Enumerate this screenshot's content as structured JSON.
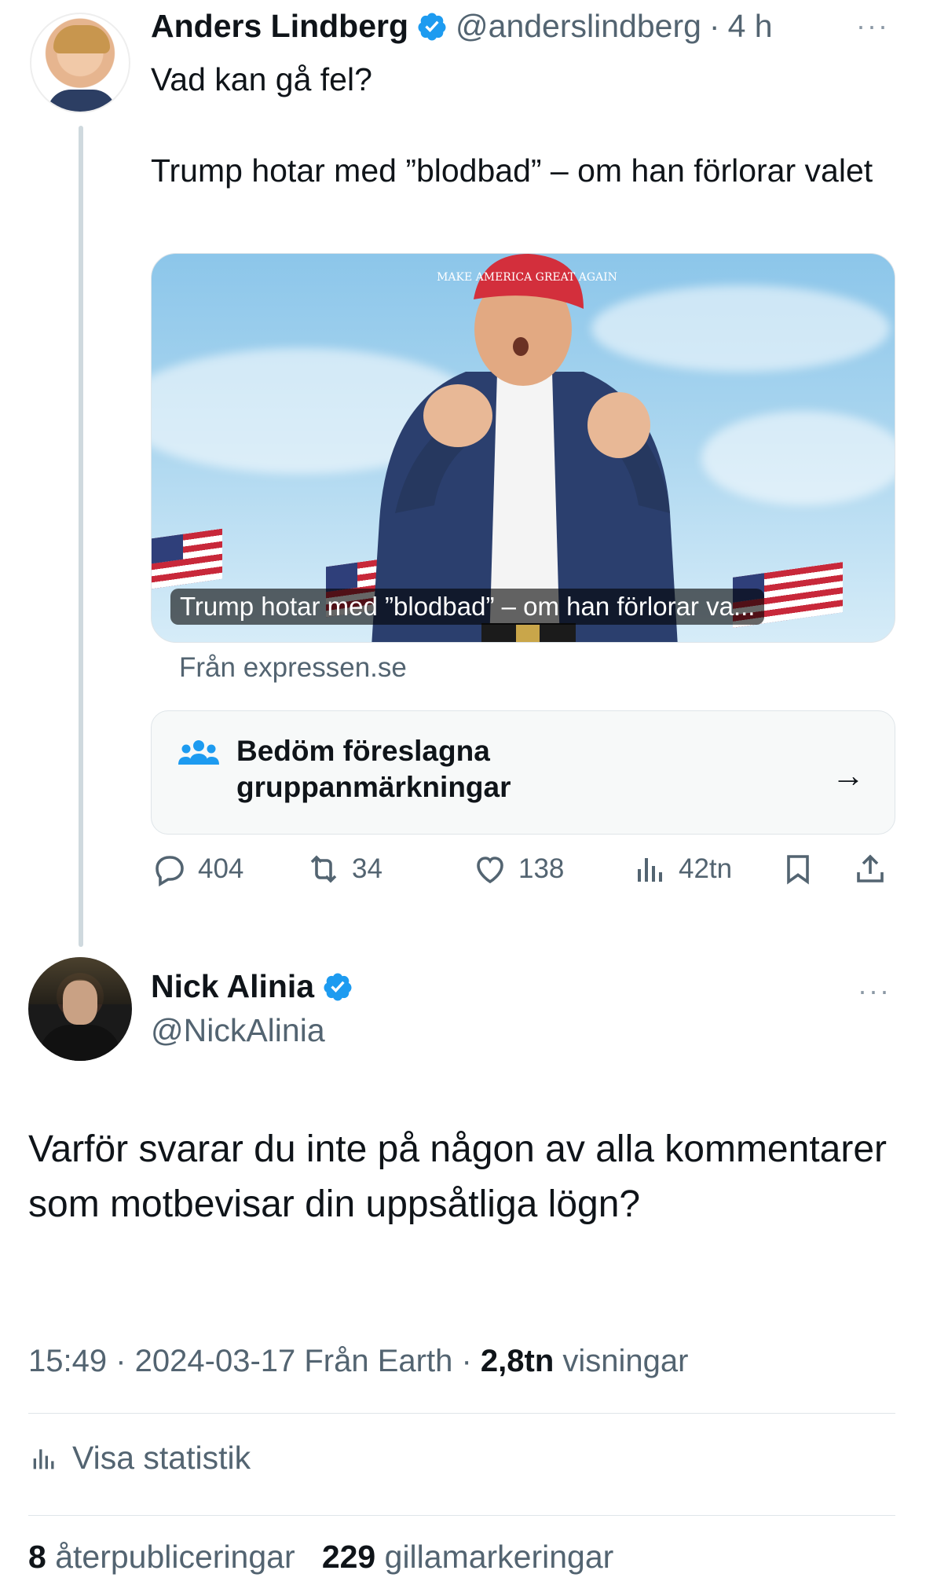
{
  "tweet1": {
    "author_name": "Anders Lindberg",
    "handle": "@anderslindberg",
    "separator": "·",
    "time": "4 h",
    "more": "···",
    "text_line1": "Vad kan gå fel?",
    "text_line2": "Trump hotar med ”blodbad” – om han förlorar valet",
    "card_caption": "Trump hotar med ”blodbad” – om han förlorar va...",
    "card_hat_text": "MAKE AMERICA GREAT AGAIN",
    "source": "Från expressen.se",
    "notes_label": "Bedöm föreslagna gruppanmärkningar",
    "notes_arrow": "→",
    "actions": {
      "replies": "404",
      "reposts": "34",
      "likes": "138",
      "views": "42tn"
    }
  },
  "tweet2": {
    "author_name": "Nick Alinia",
    "handle": "@NickAlinia",
    "more": "···",
    "text": "Varför svarar du inte på någon av alla kommentarer som motbevisar din uppsåtliga lögn?",
    "meta_time": "15:49 · 2024-03-17 Från Earth · ",
    "meta_views_count": "2,8tn",
    "meta_views_label": " visningar",
    "stats_link": "Visa statistik",
    "reposts_count": "8",
    "reposts_label": "återpubliceringar",
    "likes_count": "229",
    "likes_label": "gillamarkeringar"
  },
  "colors": {
    "text": "#0f1419",
    "secondary": "#536471",
    "verified": "#1d9bf0",
    "divider": "#dfe5e9"
  }
}
